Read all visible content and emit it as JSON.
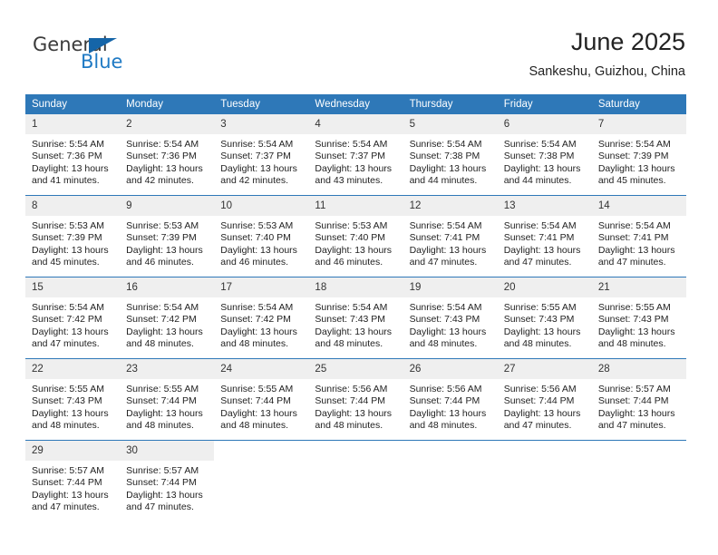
{
  "brand": {
    "name_part1": "General",
    "name_part2": "Blue"
  },
  "header": {
    "title": "June 2025",
    "location": "Sankeshu, Guizhou, China"
  },
  "calendar": {
    "weekday_headers": [
      "Sunday",
      "Monday",
      "Tuesday",
      "Wednesday",
      "Thursday",
      "Friday",
      "Saturday"
    ],
    "accent_color": "#2e78b8",
    "daynum_bg": "#efefef",
    "weeks": [
      [
        {
          "day": "1",
          "sunrise": "Sunrise: 5:54 AM",
          "sunset": "Sunset: 7:36 PM",
          "daylight1": "Daylight: 13 hours",
          "daylight2": "and 41 minutes."
        },
        {
          "day": "2",
          "sunrise": "Sunrise: 5:54 AM",
          "sunset": "Sunset: 7:36 PM",
          "daylight1": "Daylight: 13 hours",
          "daylight2": "and 42 minutes."
        },
        {
          "day": "3",
          "sunrise": "Sunrise: 5:54 AM",
          "sunset": "Sunset: 7:37 PM",
          "daylight1": "Daylight: 13 hours",
          "daylight2": "and 42 minutes."
        },
        {
          "day": "4",
          "sunrise": "Sunrise: 5:54 AM",
          "sunset": "Sunset: 7:37 PM",
          "daylight1": "Daylight: 13 hours",
          "daylight2": "and 43 minutes."
        },
        {
          "day": "5",
          "sunrise": "Sunrise: 5:54 AM",
          "sunset": "Sunset: 7:38 PM",
          "daylight1": "Daylight: 13 hours",
          "daylight2": "and 44 minutes."
        },
        {
          "day": "6",
          "sunrise": "Sunrise: 5:54 AM",
          "sunset": "Sunset: 7:38 PM",
          "daylight1": "Daylight: 13 hours",
          "daylight2": "and 44 minutes."
        },
        {
          "day": "7",
          "sunrise": "Sunrise: 5:54 AM",
          "sunset": "Sunset: 7:39 PM",
          "daylight1": "Daylight: 13 hours",
          "daylight2": "and 45 minutes."
        }
      ],
      [
        {
          "day": "8",
          "sunrise": "Sunrise: 5:53 AM",
          "sunset": "Sunset: 7:39 PM",
          "daylight1": "Daylight: 13 hours",
          "daylight2": "and 45 minutes."
        },
        {
          "day": "9",
          "sunrise": "Sunrise: 5:53 AM",
          "sunset": "Sunset: 7:39 PM",
          "daylight1": "Daylight: 13 hours",
          "daylight2": "and 46 minutes."
        },
        {
          "day": "10",
          "sunrise": "Sunrise: 5:53 AM",
          "sunset": "Sunset: 7:40 PM",
          "daylight1": "Daylight: 13 hours",
          "daylight2": "and 46 minutes."
        },
        {
          "day": "11",
          "sunrise": "Sunrise: 5:53 AM",
          "sunset": "Sunset: 7:40 PM",
          "daylight1": "Daylight: 13 hours",
          "daylight2": "and 46 minutes."
        },
        {
          "day": "12",
          "sunrise": "Sunrise: 5:54 AM",
          "sunset": "Sunset: 7:41 PM",
          "daylight1": "Daylight: 13 hours",
          "daylight2": "and 47 minutes."
        },
        {
          "day": "13",
          "sunrise": "Sunrise: 5:54 AM",
          "sunset": "Sunset: 7:41 PM",
          "daylight1": "Daylight: 13 hours",
          "daylight2": "and 47 minutes."
        },
        {
          "day": "14",
          "sunrise": "Sunrise: 5:54 AM",
          "sunset": "Sunset: 7:41 PM",
          "daylight1": "Daylight: 13 hours",
          "daylight2": "and 47 minutes."
        }
      ],
      [
        {
          "day": "15",
          "sunrise": "Sunrise: 5:54 AM",
          "sunset": "Sunset: 7:42 PM",
          "daylight1": "Daylight: 13 hours",
          "daylight2": "and 47 minutes."
        },
        {
          "day": "16",
          "sunrise": "Sunrise: 5:54 AM",
          "sunset": "Sunset: 7:42 PM",
          "daylight1": "Daylight: 13 hours",
          "daylight2": "and 48 minutes."
        },
        {
          "day": "17",
          "sunrise": "Sunrise: 5:54 AM",
          "sunset": "Sunset: 7:42 PM",
          "daylight1": "Daylight: 13 hours",
          "daylight2": "and 48 minutes."
        },
        {
          "day": "18",
          "sunrise": "Sunrise: 5:54 AM",
          "sunset": "Sunset: 7:43 PM",
          "daylight1": "Daylight: 13 hours",
          "daylight2": "and 48 minutes."
        },
        {
          "day": "19",
          "sunrise": "Sunrise: 5:54 AM",
          "sunset": "Sunset: 7:43 PM",
          "daylight1": "Daylight: 13 hours",
          "daylight2": "and 48 minutes."
        },
        {
          "day": "20",
          "sunrise": "Sunrise: 5:55 AM",
          "sunset": "Sunset: 7:43 PM",
          "daylight1": "Daylight: 13 hours",
          "daylight2": "and 48 minutes."
        },
        {
          "day": "21",
          "sunrise": "Sunrise: 5:55 AM",
          "sunset": "Sunset: 7:43 PM",
          "daylight1": "Daylight: 13 hours",
          "daylight2": "and 48 minutes."
        }
      ],
      [
        {
          "day": "22",
          "sunrise": "Sunrise: 5:55 AM",
          "sunset": "Sunset: 7:43 PM",
          "daylight1": "Daylight: 13 hours",
          "daylight2": "and 48 minutes."
        },
        {
          "day": "23",
          "sunrise": "Sunrise: 5:55 AM",
          "sunset": "Sunset: 7:44 PM",
          "daylight1": "Daylight: 13 hours",
          "daylight2": "and 48 minutes."
        },
        {
          "day": "24",
          "sunrise": "Sunrise: 5:55 AM",
          "sunset": "Sunset: 7:44 PM",
          "daylight1": "Daylight: 13 hours",
          "daylight2": "and 48 minutes."
        },
        {
          "day": "25",
          "sunrise": "Sunrise: 5:56 AM",
          "sunset": "Sunset: 7:44 PM",
          "daylight1": "Daylight: 13 hours",
          "daylight2": "and 48 minutes."
        },
        {
          "day": "26",
          "sunrise": "Sunrise: 5:56 AM",
          "sunset": "Sunset: 7:44 PM",
          "daylight1": "Daylight: 13 hours",
          "daylight2": "and 48 minutes."
        },
        {
          "day": "27",
          "sunrise": "Sunrise: 5:56 AM",
          "sunset": "Sunset: 7:44 PM",
          "daylight1": "Daylight: 13 hours",
          "daylight2": "and 47 minutes."
        },
        {
          "day": "28",
          "sunrise": "Sunrise: 5:57 AM",
          "sunset": "Sunset: 7:44 PM",
          "daylight1": "Daylight: 13 hours",
          "daylight2": "and 47 minutes."
        }
      ],
      [
        {
          "day": "29",
          "sunrise": "Sunrise: 5:57 AM",
          "sunset": "Sunset: 7:44 PM",
          "daylight1": "Daylight: 13 hours",
          "daylight2": "and 47 minutes."
        },
        {
          "day": "30",
          "sunrise": "Sunrise: 5:57 AM",
          "sunset": "Sunset: 7:44 PM",
          "daylight1": "Daylight: 13 hours",
          "daylight2": "and 47 minutes."
        },
        null,
        null,
        null,
        null,
        null
      ]
    ]
  }
}
